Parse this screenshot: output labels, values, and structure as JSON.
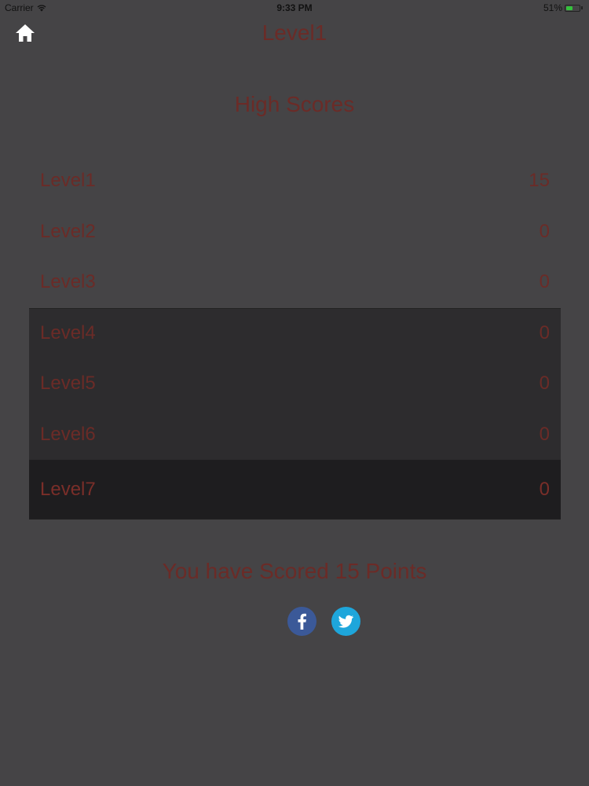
{
  "status_bar": {
    "carrier": "Carrier",
    "time": "9:33 PM",
    "battery": "51%",
    "battery_level": 0.51
  },
  "nav": {
    "title": "Level1"
  },
  "section_title": "High Scores",
  "scores": [
    {
      "level": "Level1",
      "score": "15"
    },
    {
      "level": "Level2",
      "score": "0"
    },
    {
      "level": "Level3",
      "score": "0"
    },
    {
      "level": "Level4",
      "score": "0"
    },
    {
      "level": "Level5",
      "score": "0"
    },
    {
      "level": "Level6",
      "score": "0"
    },
    {
      "level": "Level7",
      "score": "0"
    }
  ],
  "message": "You have Scored 15 Points",
  "share": {
    "facebook_label": "f",
    "twitter_label": "twitter"
  },
  "colors": {
    "background": "#454446",
    "text_accent": "#6b2b27",
    "facebook": "#3b5998",
    "twitter": "#1da1f2"
  }
}
